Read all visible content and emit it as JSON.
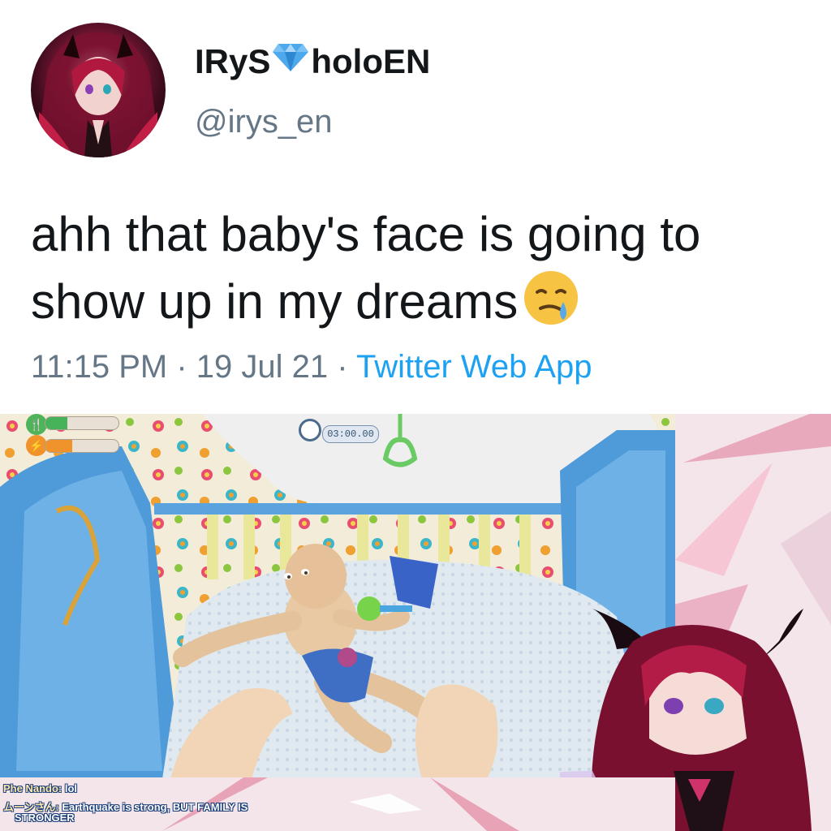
{
  "tweet": {
    "display_name_before": "IRyS",
    "display_name_after": "holoEN",
    "handle": "@irys_en",
    "text": "ahh that baby's face is going to show up in my dreams",
    "time": "11:15 PM",
    "separator": " · ",
    "date": "19 Jul 21",
    "client": "Twitter Web App",
    "emoji": "crying-face-emoji",
    "name_badge": "diamond-icon"
  },
  "stream": {
    "timer": "03:00.00",
    "hud": {
      "hunger_level": 0.3,
      "energy_level": 0.37
    },
    "chat": [
      {
        "user": "Phe Nando:",
        "message": "lol"
      },
      {
        "user": "ムーンさん:",
        "message": "Earthquake is strong, BUT FAMILY IS"
      },
      {
        "user": "",
        "message": "STRONGER"
      }
    ]
  },
  "colors": {
    "text": "#14171a",
    "secondary": "#657786",
    "link": "#1da1f2",
    "diamond": "#4ea8ec"
  }
}
